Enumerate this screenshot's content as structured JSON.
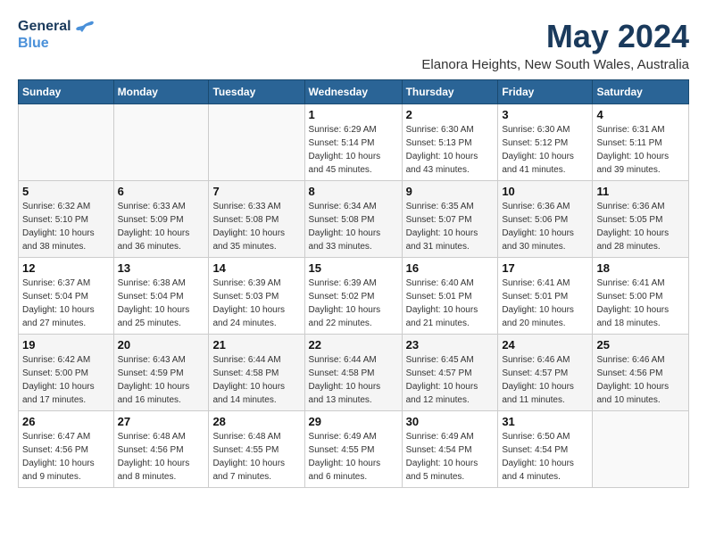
{
  "header": {
    "logo_line1": "General",
    "logo_line2": "Blue",
    "month_year": "May 2024",
    "location": "Elanora Heights, New South Wales, Australia"
  },
  "days_of_week": [
    "Sunday",
    "Monday",
    "Tuesday",
    "Wednesday",
    "Thursday",
    "Friday",
    "Saturday"
  ],
  "weeks": [
    [
      {
        "day": "",
        "info": ""
      },
      {
        "day": "",
        "info": ""
      },
      {
        "day": "",
        "info": ""
      },
      {
        "day": "1",
        "info": "Sunrise: 6:29 AM\nSunset: 5:14 PM\nDaylight: 10 hours\nand 45 minutes."
      },
      {
        "day": "2",
        "info": "Sunrise: 6:30 AM\nSunset: 5:13 PM\nDaylight: 10 hours\nand 43 minutes."
      },
      {
        "day": "3",
        "info": "Sunrise: 6:30 AM\nSunset: 5:12 PM\nDaylight: 10 hours\nand 41 minutes."
      },
      {
        "day": "4",
        "info": "Sunrise: 6:31 AM\nSunset: 5:11 PM\nDaylight: 10 hours\nand 39 minutes."
      }
    ],
    [
      {
        "day": "5",
        "info": "Sunrise: 6:32 AM\nSunset: 5:10 PM\nDaylight: 10 hours\nand 38 minutes."
      },
      {
        "day": "6",
        "info": "Sunrise: 6:33 AM\nSunset: 5:09 PM\nDaylight: 10 hours\nand 36 minutes."
      },
      {
        "day": "7",
        "info": "Sunrise: 6:33 AM\nSunset: 5:08 PM\nDaylight: 10 hours\nand 35 minutes."
      },
      {
        "day": "8",
        "info": "Sunrise: 6:34 AM\nSunset: 5:08 PM\nDaylight: 10 hours\nand 33 minutes."
      },
      {
        "day": "9",
        "info": "Sunrise: 6:35 AM\nSunset: 5:07 PM\nDaylight: 10 hours\nand 31 minutes."
      },
      {
        "day": "10",
        "info": "Sunrise: 6:36 AM\nSunset: 5:06 PM\nDaylight: 10 hours\nand 30 minutes."
      },
      {
        "day": "11",
        "info": "Sunrise: 6:36 AM\nSunset: 5:05 PM\nDaylight: 10 hours\nand 28 minutes."
      }
    ],
    [
      {
        "day": "12",
        "info": "Sunrise: 6:37 AM\nSunset: 5:04 PM\nDaylight: 10 hours\nand 27 minutes."
      },
      {
        "day": "13",
        "info": "Sunrise: 6:38 AM\nSunset: 5:04 PM\nDaylight: 10 hours\nand 25 minutes."
      },
      {
        "day": "14",
        "info": "Sunrise: 6:39 AM\nSunset: 5:03 PM\nDaylight: 10 hours\nand 24 minutes."
      },
      {
        "day": "15",
        "info": "Sunrise: 6:39 AM\nSunset: 5:02 PM\nDaylight: 10 hours\nand 22 minutes."
      },
      {
        "day": "16",
        "info": "Sunrise: 6:40 AM\nSunset: 5:01 PM\nDaylight: 10 hours\nand 21 minutes."
      },
      {
        "day": "17",
        "info": "Sunrise: 6:41 AM\nSunset: 5:01 PM\nDaylight: 10 hours\nand 20 minutes."
      },
      {
        "day": "18",
        "info": "Sunrise: 6:41 AM\nSunset: 5:00 PM\nDaylight: 10 hours\nand 18 minutes."
      }
    ],
    [
      {
        "day": "19",
        "info": "Sunrise: 6:42 AM\nSunset: 5:00 PM\nDaylight: 10 hours\nand 17 minutes."
      },
      {
        "day": "20",
        "info": "Sunrise: 6:43 AM\nSunset: 4:59 PM\nDaylight: 10 hours\nand 16 minutes."
      },
      {
        "day": "21",
        "info": "Sunrise: 6:44 AM\nSunset: 4:58 PM\nDaylight: 10 hours\nand 14 minutes."
      },
      {
        "day": "22",
        "info": "Sunrise: 6:44 AM\nSunset: 4:58 PM\nDaylight: 10 hours\nand 13 minutes."
      },
      {
        "day": "23",
        "info": "Sunrise: 6:45 AM\nSunset: 4:57 PM\nDaylight: 10 hours\nand 12 minutes."
      },
      {
        "day": "24",
        "info": "Sunrise: 6:46 AM\nSunset: 4:57 PM\nDaylight: 10 hours\nand 11 minutes."
      },
      {
        "day": "25",
        "info": "Sunrise: 6:46 AM\nSunset: 4:56 PM\nDaylight: 10 hours\nand 10 minutes."
      }
    ],
    [
      {
        "day": "26",
        "info": "Sunrise: 6:47 AM\nSunset: 4:56 PM\nDaylight: 10 hours\nand 9 minutes."
      },
      {
        "day": "27",
        "info": "Sunrise: 6:48 AM\nSunset: 4:56 PM\nDaylight: 10 hours\nand 8 minutes."
      },
      {
        "day": "28",
        "info": "Sunrise: 6:48 AM\nSunset: 4:55 PM\nDaylight: 10 hours\nand 7 minutes."
      },
      {
        "day": "29",
        "info": "Sunrise: 6:49 AM\nSunset: 4:55 PM\nDaylight: 10 hours\nand 6 minutes."
      },
      {
        "day": "30",
        "info": "Sunrise: 6:49 AM\nSunset: 4:54 PM\nDaylight: 10 hours\nand 5 minutes."
      },
      {
        "day": "31",
        "info": "Sunrise: 6:50 AM\nSunset: 4:54 PM\nDaylight: 10 hours\nand 4 minutes."
      },
      {
        "day": "",
        "info": ""
      }
    ]
  ]
}
